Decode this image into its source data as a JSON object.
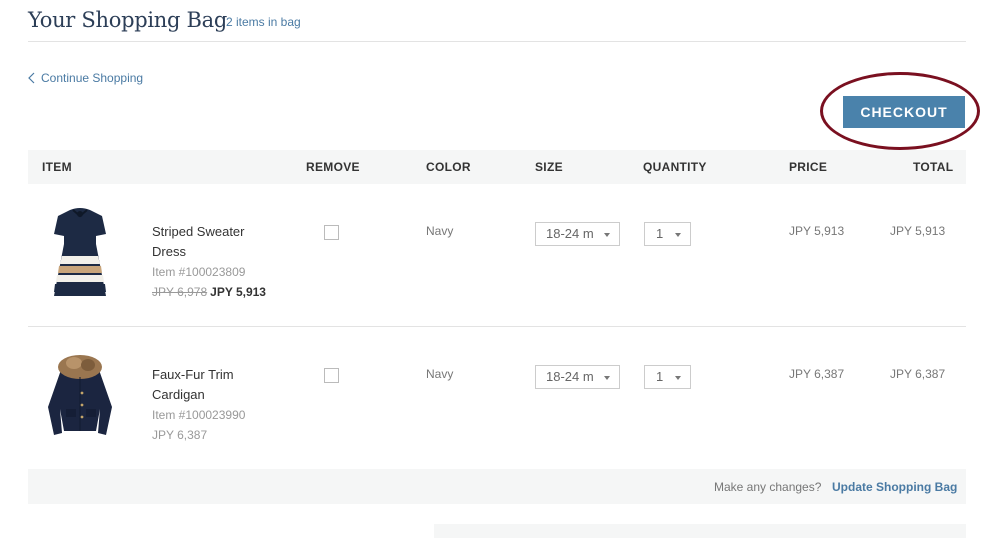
{
  "header": {
    "title": "Your Shopping Bag",
    "count": "2 items in bag"
  },
  "nav": {
    "continue_label": "Continue Shopping",
    "continue_icon": "chevron-left-icon"
  },
  "checkout": {
    "label": "CHECKOUT",
    "color": "#4a82ab",
    "highlight_color": "#7a1020"
  },
  "table": {
    "columns": {
      "item": "ITEM",
      "remove": "REMOVE",
      "color": "COLOR",
      "size": "SIZE",
      "quantity": "QUANTITY",
      "price": "PRICE",
      "total": "TOTAL"
    },
    "rows": [
      {
        "name": "Striped Sweater Dress",
        "item_number": "Item #100023809",
        "original_price": "JPY 6,978",
        "sale_price": "JPY 5,913",
        "remove_checked": false,
        "color": "Navy",
        "size": "18-24 m",
        "quantity": "1",
        "price": "JPY 5,913",
        "total": "JPY 5,913"
      },
      {
        "name": "Faux-Fur Trim Cardigan",
        "item_number": "Item #100023990",
        "price_text": "JPY 6,387",
        "remove_checked": false,
        "color": "Navy",
        "size": "18-24 m",
        "quantity": "1",
        "price": "JPY 6,387",
        "total": "JPY 6,387"
      }
    ]
  },
  "footer": {
    "prompt": "Make any changes?",
    "update_label": "Update Shopping Bag"
  }
}
